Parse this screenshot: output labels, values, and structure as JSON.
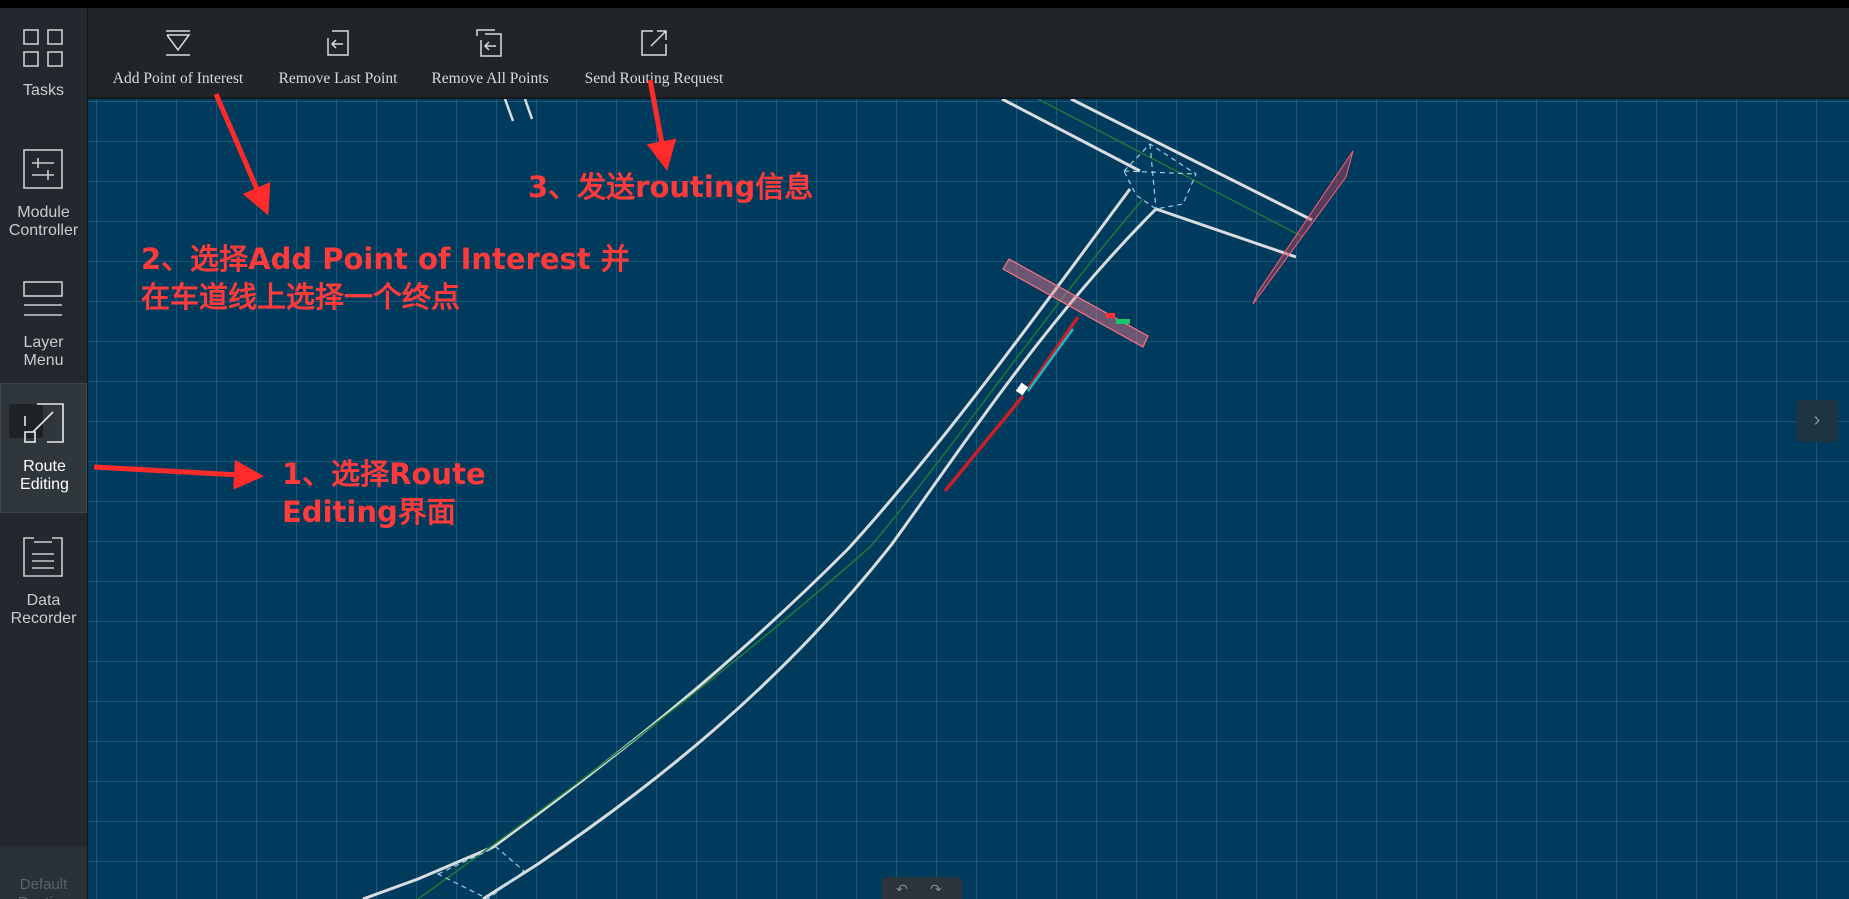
{
  "sidebar": {
    "items": [
      {
        "label": "Tasks",
        "icon": "tasks-icon"
      },
      {
        "label": "Module\nController",
        "icon": "module-controller-icon"
      },
      {
        "label": "Layer\nMenu",
        "icon": "layer-menu-icon"
      },
      {
        "label": "Route\nEditing",
        "icon": "route-editing-icon",
        "active": true
      },
      {
        "label": "Data\nRecorder",
        "icon": "data-recorder-icon"
      }
    ],
    "default_routing": "Default\nRouting"
  },
  "toolbar": {
    "add_point": "Add Point of Interest",
    "remove_last": "Remove Last Point",
    "remove_all": "Remove All Points",
    "send_routing": "Send Routing Request"
  },
  "map": {
    "panel_toggle": "›",
    "nav_prev": "↶",
    "nav_next": "↷"
  },
  "annotations": {
    "step1": "1、选择Route\n   Editing界面",
    "step2": "2、选择Add Point of Interest 并\n   在车道线上选择一个终点",
    "step3": "3、发送routing信息"
  },
  "colors": {
    "sidebar_bg": "#22282d",
    "toolbar_bg": "#1f2529",
    "map_bg": "#003a5c",
    "annotation": "#ff3a3a"
  }
}
